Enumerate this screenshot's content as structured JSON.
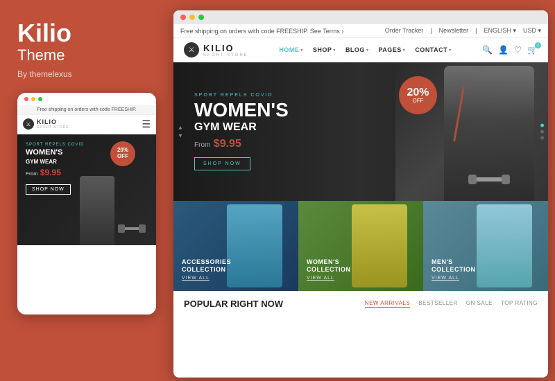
{
  "brand": {
    "name": "Kilio",
    "subtitle": "Theme",
    "by": "By themelexus"
  },
  "mobile": {
    "announcement": "Free shipping on orders with code FREESHIP.",
    "logo_name": "KILIO",
    "logo_sub": "SPORT STORE",
    "hero_eyebrow": "SPORT REPELS COVID",
    "hero_title_line1": "WOMEN'S",
    "hero_title_line2": "GYM WEAR",
    "hero_from": "From",
    "hero_price": "$9.95",
    "hero_badge_percent": "20%",
    "hero_badge_off": "OFF",
    "shop_now": "SHOP NOW"
  },
  "browser": {
    "announcement_left": "Free shipping on orders with code FREESHIP. See Terms  ›",
    "announcement_right": [
      "Order Tracker",
      "Newsletter",
      "ENGLISH",
      "USD"
    ],
    "logo_name": "KILIO",
    "logo_sub": "SPORT STORE",
    "nav_items": [
      {
        "label": "HOME",
        "active": true,
        "has_dropdown": true
      },
      {
        "label": "SHOP",
        "has_dropdown": true
      },
      {
        "label": "BLOG",
        "has_dropdown": true
      },
      {
        "label": "PAGES",
        "has_dropdown": true
      },
      {
        "label": "CONTACT",
        "has_dropdown": true
      }
    ],
    "hero": {
      "eyebrow": "SPORT REPELS COVID",
      "title": "WOMEN'S",
      "subtitle": "GYM WEAR",
      "from": "From",
      "price": "$9.95",
      "badge_percent": "20%",
      "badge_off": "OFF",
      "cta": "SHOP NOW"
    },
    "collections": [
      {
        "title": "ACCESSORIES\nCOLLECTION",
        "link": "VIEW ALL"
      },
      {
        "title": "WOMEN'S\nCOLLECTION",
        "link": "VIEW ALL"
      },
      {
        "title": "MEN'S\nCOLLECTION",
        "link": "VIEW ALL"
      }
    ],
    "popular_section_title": "POPULAR RIGHT NOW",
    "popular_tabs": [
      "NEW ARRIVALS",
      "BESTSELLER",
      "ON SALE",
      "TOP RATING"
    ]
  }
}
